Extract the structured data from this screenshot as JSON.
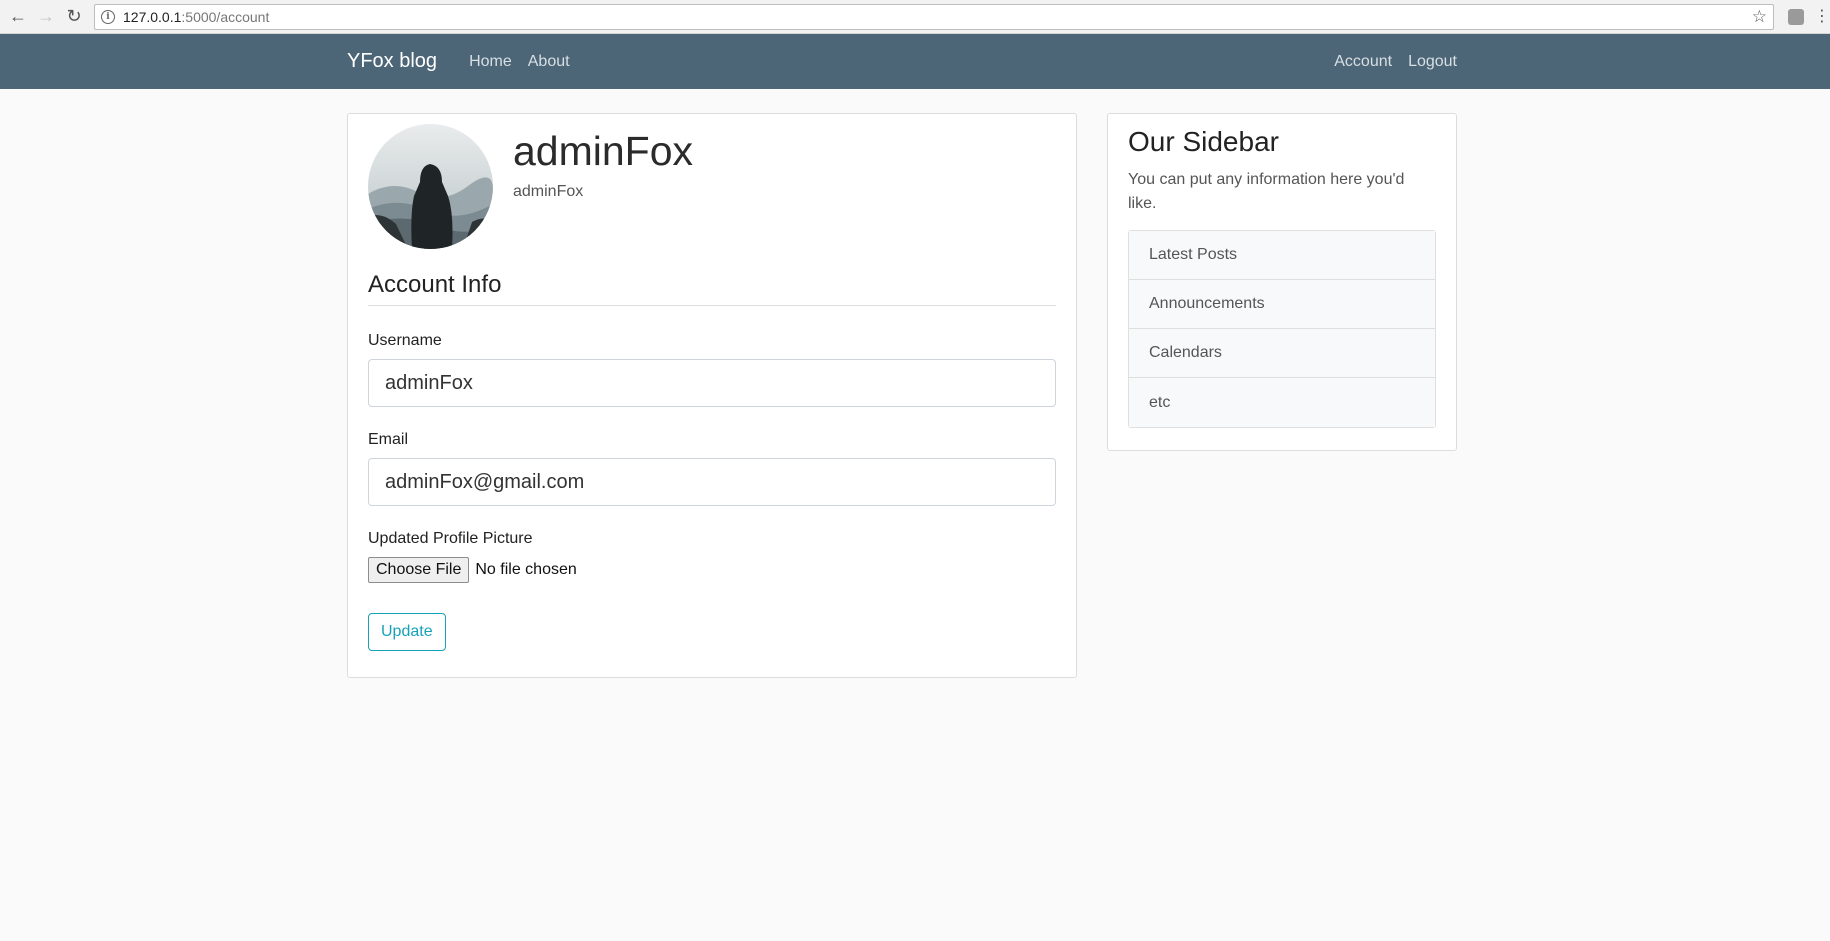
{
  "browser": {
    "url_host": "127.0.0.1",
    "url_path": ":5000/account"
  },
  "navbar": {
    "brand": "YFox blog",
    "left_links": [
      "Home",
      "About"
    ],
    "right_links": [
      "Account",
      "Logout"
    ]
  },
  "profile": {
    "name": "adminFox",
    "subtitle": "adminFox"
  },
  "form": {
    "legend": "Account Info",
    "username_label": "Username",
    "username_value": "adminFox",
    "email_label": "Email",
    "email_value": "adminFox@gmail.com",
    "picture_label": "Updated Profile Picture",
    "file_button": "Choose File",
    "file_status": "No file chosen",
    "submit": "Update"
  },
  "sidebar": {
    "title": "Our Sidebar",
    "description": "You can put any information here you'd like.",
    "items": [
      "Latest Posts",
      "Announcements",
      "Calendars",
      "etc"
    ]
  },
  "colors": {
    "navbar_bg": "#4d6677",
    "accent": "#17a2b8"
  }
}
